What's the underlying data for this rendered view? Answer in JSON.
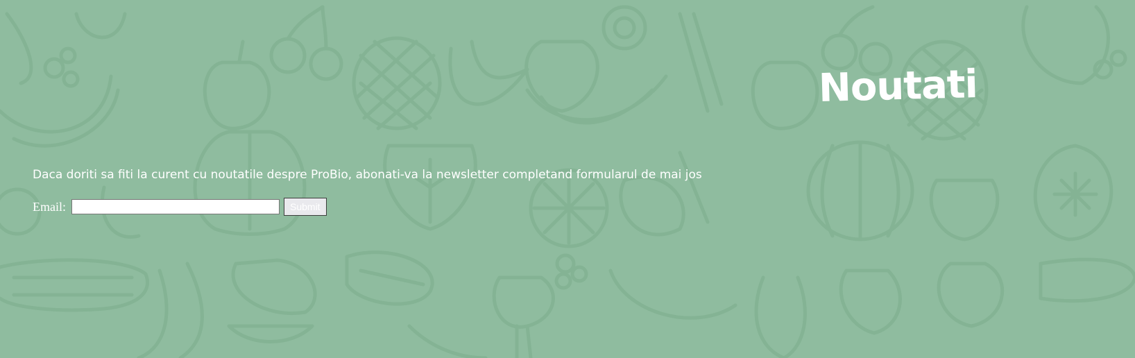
{
  "header": {
    "title": "Noutati"
  },
  "main": {
    "intro_text": "Daca doriti sa fiti la curent cu noutatile despre ProBio, abonati-va la newsletter completand formularul de mai jos"
  },
  "form": {
    "email_label": "Email:",
    "email_value": "",
    "email_placeholder": "",
    "submit_label": "Submit"
  },
  "theme": {
    "background_color": "#8fbc9f",
    "pattern_color": "#84b394",
    "text_color": "#ffffff"
  },
  "icons": {
    "background_pattern": "fruit-vegetable-pattern"
  }
}
